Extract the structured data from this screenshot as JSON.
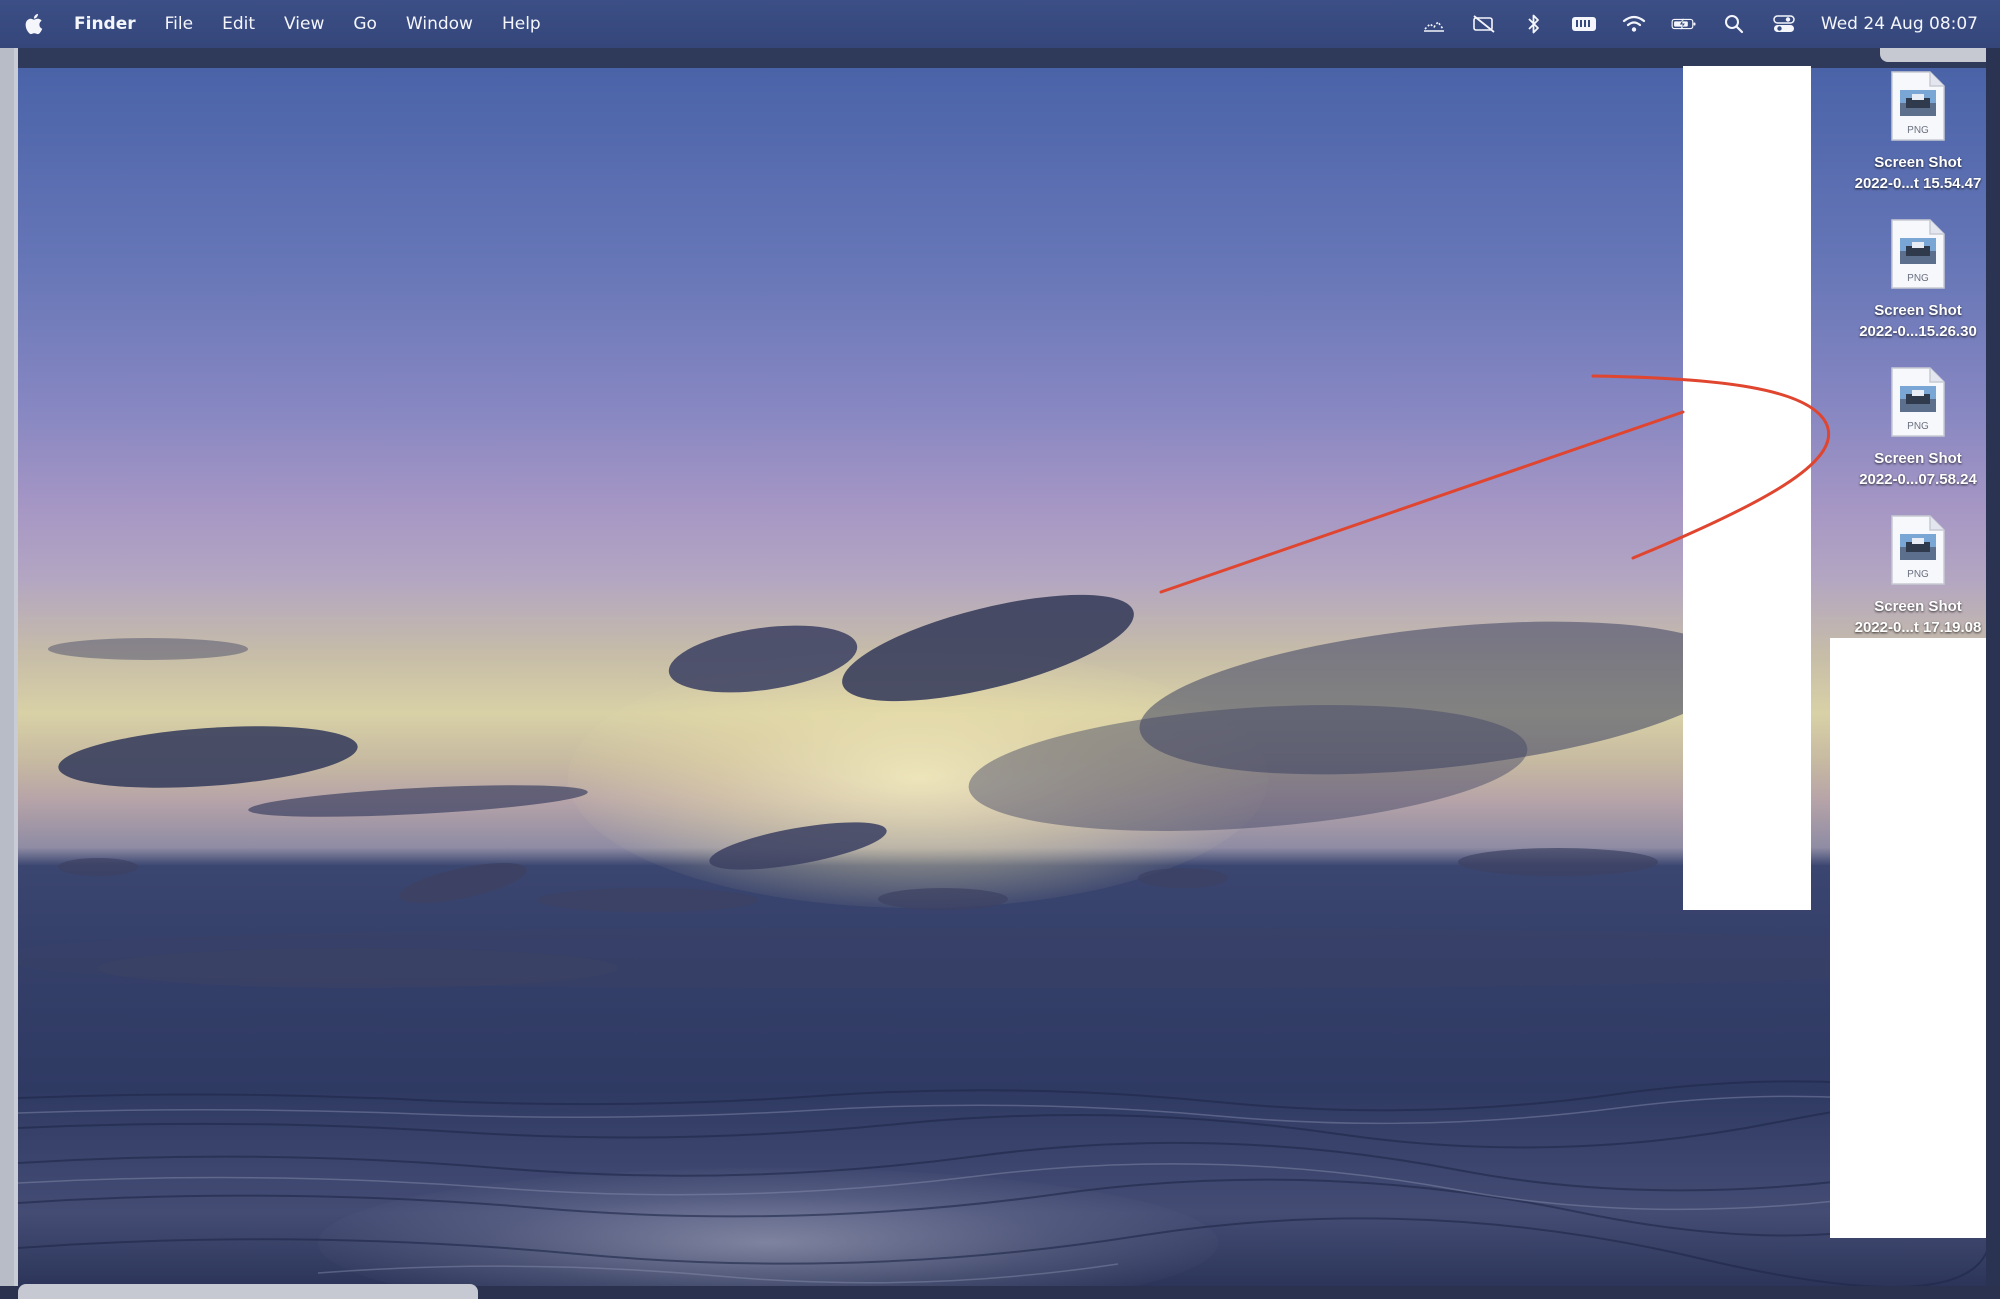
{
  "menubar": {
    "apple_icon": "apple-logo-icon",
    "app_name": "Finder",
    "items": [
      {
        "label": "File"
      },
      {
        "label": "Edit"
      },
      {
        "label": "View"
      },
      {
        "label": "Go"
      },
      {
        "label": "Window"
      },
      {
        "label": "Help"
      }
    ],
    "status_icons": [
      "weather-icon",
      "screen-mirroring-muted-icon",
      "bluetooth-icon",
      "keyboard-input-icon",
      "wifi-icon",
      "battery-charging-icon",
      "spotlight-search-icon",
      "control-center-icon"
    ],
    "clock": "Wed 24 Aug  08:07"
  },
  "desktop": {
    "icons": [
      {
        "type_label": "PNG",
        "line1": "Screen Shot",
        "line2": "2022-0...t 15.54.47"
      },
      {
        "type_label": "PNG",
        "line1": "Screen Shot",
        "line2": "2022-0...15.26.30"
      },
      {
        "type_label": "PNG",
        "line1": "Screen Shot",
        "line2": "2022-0...07.58.24"
      },
      {
        "type_label": "PNG",
        "line1": "Screen Shot",
        "line2": "2022-0...t 17.19.08"
      }
    ]
  },
  "colors": {
    "menubar": "#3a4c82",
    "annotation_red": "#e0452f",
    "icon_label": "#ffffff"
  }
}
